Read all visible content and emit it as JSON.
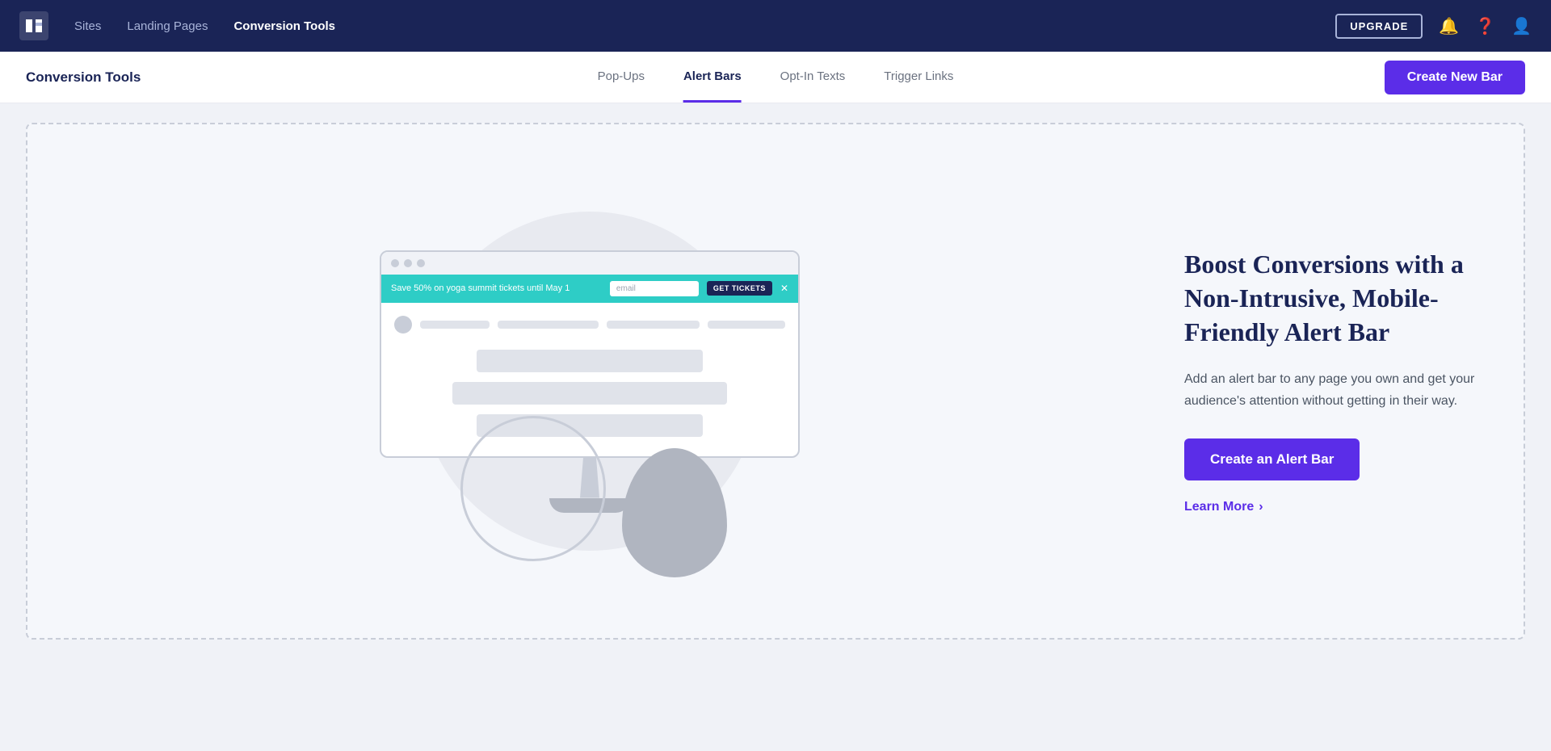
{
  "topNav": {
    "navLinks": [
      {
        "id": "sites",
        "label": "Sites",
        "active": false
      },
      {
        "id": "landing-pages",
        "label": "Landing Pages",
        "active": false
      },
      {
        "id": "conversion-tools",
        "label": "Conversion Tools",
        "active": true
      }
    ],
    "upgradeLabel": "UPGRADE",
    "notificationIcon": "bell",
    "helpIcon": "question",
    "userIcon": "user"
  },
  "subNav": {
    "title": "Conversion Tools",
    "tabs": [
      {
        "id": "pop-ups",
        "label": "Pop-Ups",
        "active": false
      },
      {
        "id": "alert-bars",
        "label": "Alert Bars",
        "active": true
      },
      {
        "id": "opt-in-texts",
        "label": "Opt-In Texts",
        "active": false
      },
      {
        "id": "trigger-links",
        "label": "Trigger Links",
        "active": false
      }
    ],
    "createButton": "Create New Bar"
  },
  "mainContent": {
    "illustration": {
      "alertBarText": "Save 50% on yoga summit tickets until May 1",
      "emailPlaceholder": "email",
      "getTicketsLabel": "GET TICKETS"
    },
    "headline": "Boost Conversions with a Non-Intrusive, Mobile-Friendly Alert Bar",
    "description": "Add an alert bar to any page you own and get your audience's attention without getting in their way.",
    "createAlertButton": "Create an Alert Bar",
    "learnMoreLabel": "Learn More",
    "learnMoreArrow": "›"
  }
}
